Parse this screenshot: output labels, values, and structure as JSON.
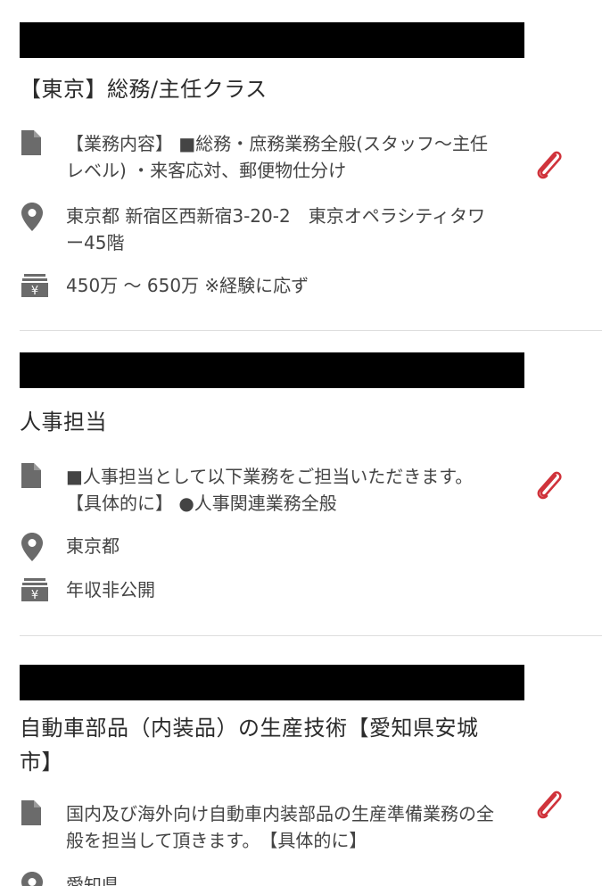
{
  "accent_color": "#d0333b",
  "icon_color": "#6b6b6b",
  "listings": [
    {
      "title": "【東京】総務/主任クラス",
      "description": "【業務内容】 ■総務・庶務業務全般(スタッフ〜主任レベル) ・来客応対、郵便物仕分け",
      "location": "東京都 新宿区西新宿3-20-2　東京オペラシティタワー45階",
      "salary": "450万 〜 650万 ※経験に応ず"
    },
    {
      "title": "人事担当",
      "description": "■人事担当として以下業務をご担当いただきます。　【具体的に】 ●人事関連業務全般",
      "location": "東京都",
      "salary": "年収非公開"
    },
    {
      "title": "自動車部品（内装品）の生産技術【愛知県安城市】",
      "description": "国内及び海外向け自動車内装部品の生産準備業務の全般を担当して頂きます。　【具体的に】",
      "location": "愛知県"
    }
  ],
  "icons": {
    "description": "document-icon",
    "location": "map-pin-icon",
    "salary": "yen-register-icon",
    "attachment": "paperclip-icon"
  }
}
